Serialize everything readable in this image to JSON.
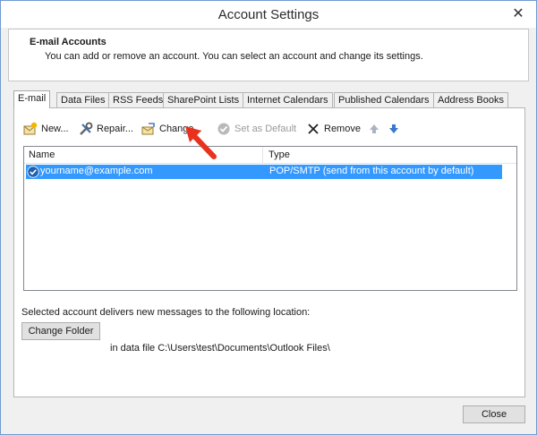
{
  "window": {
    "title": "Account Settings",
    "close_glyph": "✕"
  },
  "header": {
    "title": "E-mail Accounts",
    "description": "You can add or remove an account. You can select an account and change its settings."
  },
  "tabs": [
    {
      "label": "E-mail",
      "active": true
    },
    {
      "label": "Data Files"
    },
    {
      "label": "RSS Feeds"
    },
    {
      "label": "SharePoint Lists"
    },
    {
      "label": "Internet Calendars"
    },
    {
      "label": "Published Calendars"
    },
    {
      "label": "Address Books"
    }
  ],
  "toolbar": {
    "new_label": "New...",
    "repair_label": "Repair...",
    "change_label": "Change...",
    "set_default_label": "Set as Default",
    "remove_label": "Remove",
    "icons": [
      "new-account-icon",
      "repair-icon",
      "change-icon",
      "set-default-icon",
      "remove-icon",
      "move-up-icon",
      "move-down-icon"
    ]
  },
  "list": {
    "columns": [
      "Name",
      "Type"
    ],
    "rows": [
      {
        "name": "yourname@example.com",
        "type": "POP/SMTP (send from this account by default)",
        "selected": true
      }
    ]
  },
  "delivery": {
    "label": "Selected account delivers new messages to the following location:",
    "change_folder_label": "Change Folder",
    "data_file_text": "in data file C:\\Users\\test\\Documents\\Outlook Files\\"
  },
  "footer": {
    "close_label": "Close"
  },
  "colors": {
    "selection": "#3399ff",
    "callout_arrow": "#e8321e",
    "window_border": "#6f9bd1"
  }
}
